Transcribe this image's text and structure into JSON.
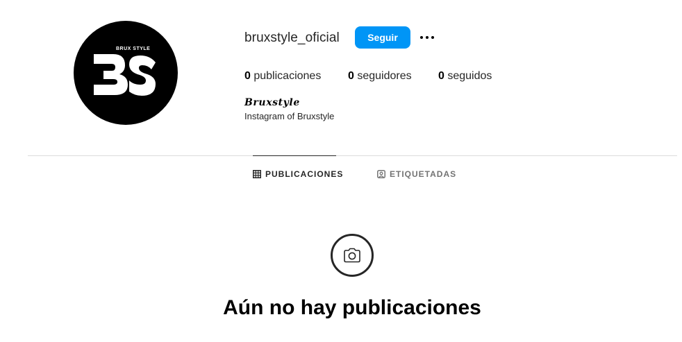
{
  "profile": {
    "username": "bruxstyle_oficial",
    "follow_label": "Seguir",
    "avatar_logo_text": "BS",
    "avatar_logo_caption": "BRUX STYLE"
  },
  "stats": [
    {
      "count": "0",
      "label": "publicaciones"
    },
    {
      "count": "0",
      "label": "seguidores"
    },
    {
      "count": "0",
      "label": "seguidos"
    }
  ],
  "bio": {
    "name": "Bruxstyle",
    "text": "Instagram of Bruxstyle"
  },
  "tabs": [
    {
      "label": "PUBLICACIONES",
      "icon": "grid-icon",
      "active": true
    },
    {
      "label": "ETIQUETADAS",
      "icon": "tagged-icon",
      "active": false
    }
  ],
  "empty_state": {
    "icon": "camera-icon",
    "title": "Aún no hay publicaciones"
  },
  "colors": {
    "accent": "#0095f6",
    "divider": "#dbdbdb",
    "muted": "#737373"
  }
}
